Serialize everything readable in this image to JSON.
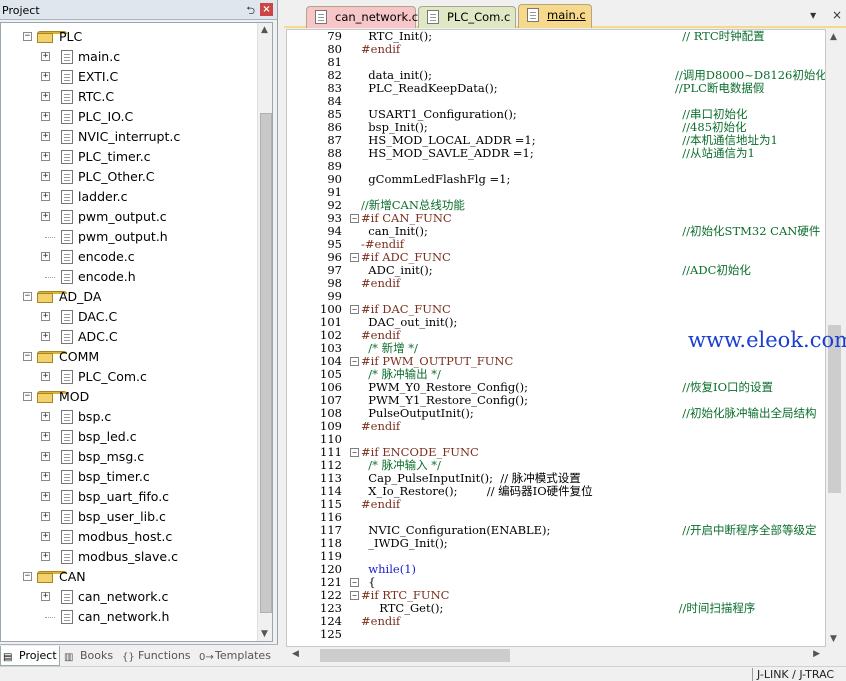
{
  "project_panel": {
    "title": "Project",
    "pin_glyph": "⮌",
    "close_glyph": "×",
    "tree": [
      {
        "type": "folder",
        "label": "PLC",
        "depth": 0,
        "expanded": true
      },
      {
        "type": "file",
        "label": "main.c",
        "depth": 1,
        "expandable": true
      },
      {
        "type": "file",
        "label": "EXTI.C",
        "depth": 1,
        "expandable": true
      },
      {
        "type": "file",
        "label": "RTC.C",
        "depth": 1,
        "expandable": true
      },
      {
        "type": "file",
        "label": "PLC_IO.C",
        "depth": 1,
        "expandable": true
      },
      {
        "type": "file",
        "label": "NVIC_interrupt.c",
        "depth": 1,
        "expandable": true
      },
      {
        "type": "file",
        "label": "PLC_timer.c",
        "depth": 1,
        "expandable": true
      },
      {
        "type": "file",
        "label": "PLC_Other.C",
        "depth": 1,
        "expandable": true
      },
      {
        "type": "file",
        "label": "ladder.c",
        "depth": 1,
        "expandable": true
      },
      {
        "type": "file",
        "label": "pwm_output.c",
        "depth": 1,
        "expandable": true
      },
      {
        "type": "file",
        "label": "pwm_output.h",
        "depth": 1,
        "expandable": false
      },
      {
        "type": "file",
        "label": "encode.c",
        "depth": 1,
        "expandable": true
      },
      {
        "type": "file",
        "label": "encode.h",
        "depth": 1,
        "expandable": false
      },
      {
        "type": "folder",
        "label": "AD_DA",
        "depth": 0,
        "expanded": true
      },
      {
        "type": "file",
        "label": "DAC.C",
        "depth": 1,
        "expandable": true
      },
      {
        "type": "file",
        "label": "ADC.C",
        "depth": 1,
        "expandable": true
      },
      {
        "type": "folder",
        "label": "COMM",
        "depth": 0,
        "expanded": true
      },
      {
        "type": "file",
        "label": "PLC_Com.c",
        "depth": 1,
        "expandable": true
      },
      {
        "type": "folder",
        "label": "MOD",
        "depth": 0,
        "expanded": true
      },
      {
        "type": "file",
        "label": "bsp.c",
        "depth": 1,
        "expandable": true
      },
      {
        "type": "file",
        "label": "bsp_led.c",
        "depth": 1,
        "expandable": true
      },
      {
        "type": "file",
        "label": "bsp_msg.c",
        "depth": 1,
        "expandable": true
      },
      {
        "type": "file",
        "label": "bsp_timer.c",
        "depth": 1,
        "expandable": true
      },
      {
        "type": "file",
        "label": "bsp_uart_fifo.c",
        "depth": 1,
        "expandable": true
      },
      {
        "type": "file",
        "label": "bsp_user_lib.c",
        "depth": 1,
        "expandable": true
      },
      {
        "type": "file",
        "label": "modbus_host.c",
        "depth": 1,
        "expandable": true
      },
      {
        "type": "file",
        "label": "modbus_slave.c",
        "depth": 1,
        "expandable": true
      },
      {
        "type": "folder",
        "label": "CAN",
        "depth": 0,
        "expanded": true
      },
      {
        "type": "file",
        "label": "can_network.c",
        "depth": 1,
        "expandable": true
      },
      {
        "type": "file",
        "label": "can_network.h",
        "depth": 1,
        "expandable": false
      }
    ],
    "bottom_tabs": [
      {
        "label": "Project",
        "active": true,
        "icon": "project-icon"
      },
      {
        "label": "Books",
        "active": false,
        "icon": "books-icon"
      },
      {
        "label": "Functions",
        "active": false,
        "icon": "functions-icon"
      },
      {
        "label": "Templates",
        "active": false,
        "icon": "templates-icon"
      }
    ]
  },
  "editor": {
    "tabs": [
      {
        "label": "can_network.c",
        "color": "#f7c6c9",
        "active": false
      },
      {
        "label": "PLC_Com.c",
        "color": "#dfe8c4",
        "active": false
      },
      {
        "label": "main.c",
        "color": "#f7d98b",
        "active": true
      }
    ],
    "tab_controls": {
      "dropdown": "▾",
      "close": "×"
    },
    "lines": [
      {
        "n": "79",
        "fold": "",
        "code": "  RTC_Init();",
        "comment": "  // RTC时钟配置",
        "kind": "normal"
      },
      {
        "n": "80",
        "fold": "",
        "code": "#endif",
        "comment": "",
        "kind": "pp"
      },
      {
        "n": "81",
        "fold": "",
        "code": "",
        "comment": "",
        "kind": "normal"
      },
      {
        "n": "82",
        "fold": "",
        "code": "  data_init();",
        "comment": "//调用D8000~D8126初始化",
        "kind": "normal"
      },
      {
        "n": "83",
        "fold": "",
        "code": "  PLC_ReadKeepData();",
        "comment": "//PLC断电数据假",
        "kind": "normal"
      },
      {
        "n": "84",
        "fold": "",
        "code": "",
        "comment": "",
        "kind": "normal"
      },
      {
        "n": "85",
        "fold": "",
        "code": "  USART1_Configuration();",
        "comment": "  //串口初始化",
        "kind": "normal"
      },
      {
        "n": "86",
        "fold": "",
        "code": "  bsp_Init();",
        "comment": "  //485初始化",
        "kind": "normal"
      },
      {
        "n": "87",
        "fold": "",
        "code": "  HS_MOD_LOCAL_ADDR =1;",
        "comment": "  //本机通信地址为1",
        "kind": "normal"
      },
      {
        "n": "88",
        "fold": "",
        "code": "  HS_MOD_SAVLE_ADDR =1;",
        "comment": "  //从站通信为1",
        "kind": "normal"
      },
      {
        "n": "89",
        "fold": "",
        "code": "",
        "comment": "",
        "kind": "normal"
      },
      {
        "n": "90",
        "fold": "",
        "code": "  gCommLedFlashFlg =1;",
        "comment": "",
        "kind": "normal"
      },
      {
        "n": "91",
        "fold": "",
        "code": "",
        "comment": "",
        "kind": "normal"
      },
      {
        "n": "92",
        "fold": "",
        "code": "//新增CAN总线功能",
        "comment": "",
        "kind": "comment"
      },
      {
        "n": "93",
        "fold": "−",
        "code": "#if CAN_FUNC",
        "comment": "",
        "kind": "pp"
      },
      {
        "n": "94",
        "fold": "",
        "code": "  can_Init();",
        "comment": "  //初始化STM32 CAN硬件",
        "kind": "normal"
      },
      {
        "n": "95",
        "fold": "",
        "code": "-#endif",
        "comment": "",
        "kind": "pp"
      },
      {
        "n": "96",
        "fold": "−",
        "code": "#if ADC_FUNC",
        "comment": "",
        "kind": "pp"
      },
      {
        "n": "97",
        "fold": "",
        "code": "  ADC_init();",
        "comment": "  //ADC初始化",
        "kind": "normal"
      },
      {
        "n": "98",
        "fold": "",
        "code": "#endif",
        "comment": "",
        "kind": "pp"
      },
      {
        "n": "99",
        "fold": "",
        "code": "",
        "comment": "",
        "kind": "normal"
      },
      {
        "n": "100",
        "fold": "−",
        "code": "#if DAC_FUNC",
        "comment": "",
        "kind": "pp"
      },
      {
        "n": "101",
        "fold": "",
        "code": "  DAC_out_init();",
        "comment": "",
        "kind": "normal"
      },
      {
        "n": "102",
        "fold": "",
        "code": "#endif",
        "comment": "",
        "kind": "pp"
      },
      {
        "n": "103",
        "fold": "",
        "code": "  /* 新增 */",
        "comment": "",
        "kind": "comment"
      },
      {
        "n": "104",
        "fold": "−",
        "code": "#if PWM_OUTPUT_FUNC",
        "comment": "",
        "kind": "pp"
      },
      {
        "n": "105",
        "fold": "",
        "code": "  /* 脉冲输出 */",
        "comment": "",
        "kind": "comment"
      },
      {
        "n": "106",
        "fold": "",
        "code": "  PWM_Y0_Restore_Config();",
        "comment": "  //恢复IO口的设置",
        "kind": "normal"
      },
      {
        "n": "107",
        "fold": "",
        "code": "  PWM_Y1_Restore_Config();",
        "comment": "",
        "kind": "normal"
      },
      {
        "n": "108",
        "fold": "",
        "code": "  PulseOutputInit();",
        "comment": "  //初始化脉冲输出全局结构",
        "kind": "normal"
      },
      {
        "n": "109",
        "fold": "",
        "code": "#endif",
        "comment": "",
        "kind": "pp"
      },
      {
        "n": "110",
        "fold": "",
        "code": "",
        "comment": "",
        "kind": "normal"
      },
      {
        "n": "111",
        "fold": "−",
        "code": "#if ENCODE_FUNC",
        "comment": "",
        "kind": "pp"
      },
      {
        "n": "112",
        "fold": "",
        "code": "  /* 脉冲输入 */",
        "comment": "",
        "kind": "comment"
      },
      {
        "n": "113",
        "fold": "",
        "code": "  Cap_PulseInputInit();  // 脉冲模式设置",
        "comment": "",
        "kind": "mixed"
      },
      {
        "n": "114",
        "fold": "",
        "code": "  X_Io_Restore();        // 编码器IO硬件复位",
        "comment": "",
        "kind": "mixed"
      },
      {
        "n": "115",
        "fold": "",
        "code": "#endif",
        "comment": "",
        "kind": "pp"
      },
      {
        "n": "116",
        "fold": "",
        "code": "",
        "comment": "",
        "kind": "normal"
      },
      {
        "n": "117",
        "fold": "",
        "code": "  NVIC_Configuration(ENABLE);",
        "comment": "  //开启中断程序全部等级定",
        "kind": "normal"
      },
      {
        "n": "118",
        "fold": "",
        "code": "  _IWDG_Init();",
        "comment": "",
        "kind": "normal"
      },
      {
        "n": "119",
        "fold": "",
        "code": "",
        "comment": "",
        "kind": "normal"
      },
      {
        "n": "120",
        "fold": "",
        "code": "  while(1)",
        "comment": "",
        "kind": "kw"
      },
      {
        "n": "121",
        "fold": "−",
        "code": "  {",
        "comment": "",
        "kind": "normal"
      },
      {
        "n": "122",
        "fold": "−",
        "code": "#if RTC_FUNC",
        "comment": "",
        "kind": "pp"
      },
      {
        "n": "123",
        "fold": "",
        "code": "     RTC_Get();",
        "comment": " //时间扫描程序",
        "kind": "normal"
      },
      {
        "n": "124",
        "fold": "",
        "code": "#endif",
        "comment": "",
        "kind": "pp"
      },
      {
        "n": "125",
        "fold": "",
        "code": "",
        "comment": "",
        "kind": "normal"
      }
    ]
  },
  "watermark": "www.eleok.com",
  "status_bar": {
    "debugger": "J-LINK / J-TRAC"
  }
}
